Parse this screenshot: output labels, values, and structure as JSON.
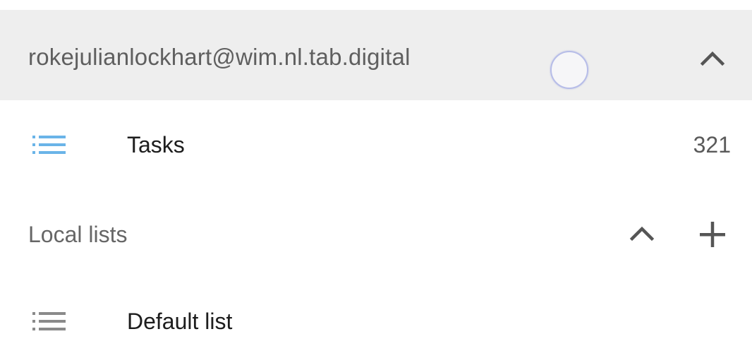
{
  "account": {
    "email": "rokejulianlockhart@wim.nl.tab.digital",
    "collapse_icon": "chevron-up-icon",
    "loading_indicator": "loading-ring"
  },
  "lists": {
    "tasks": {
      "icon": "list-icon",
      "icon_color": "#6ab4e8",
      "label": "Tasks",
      "count": "321"
    }
  },
  "local_section": {
    "label": "Local lists",
    "collapse_icon": "chevron-up-icon",
    "add_icon": "plus-icon",
    "items": [
      {
        "icon": "list-icon",
        "icon_color": "#8a8a8a",
        "label": "Default list"
      }
    ]
  }
}
